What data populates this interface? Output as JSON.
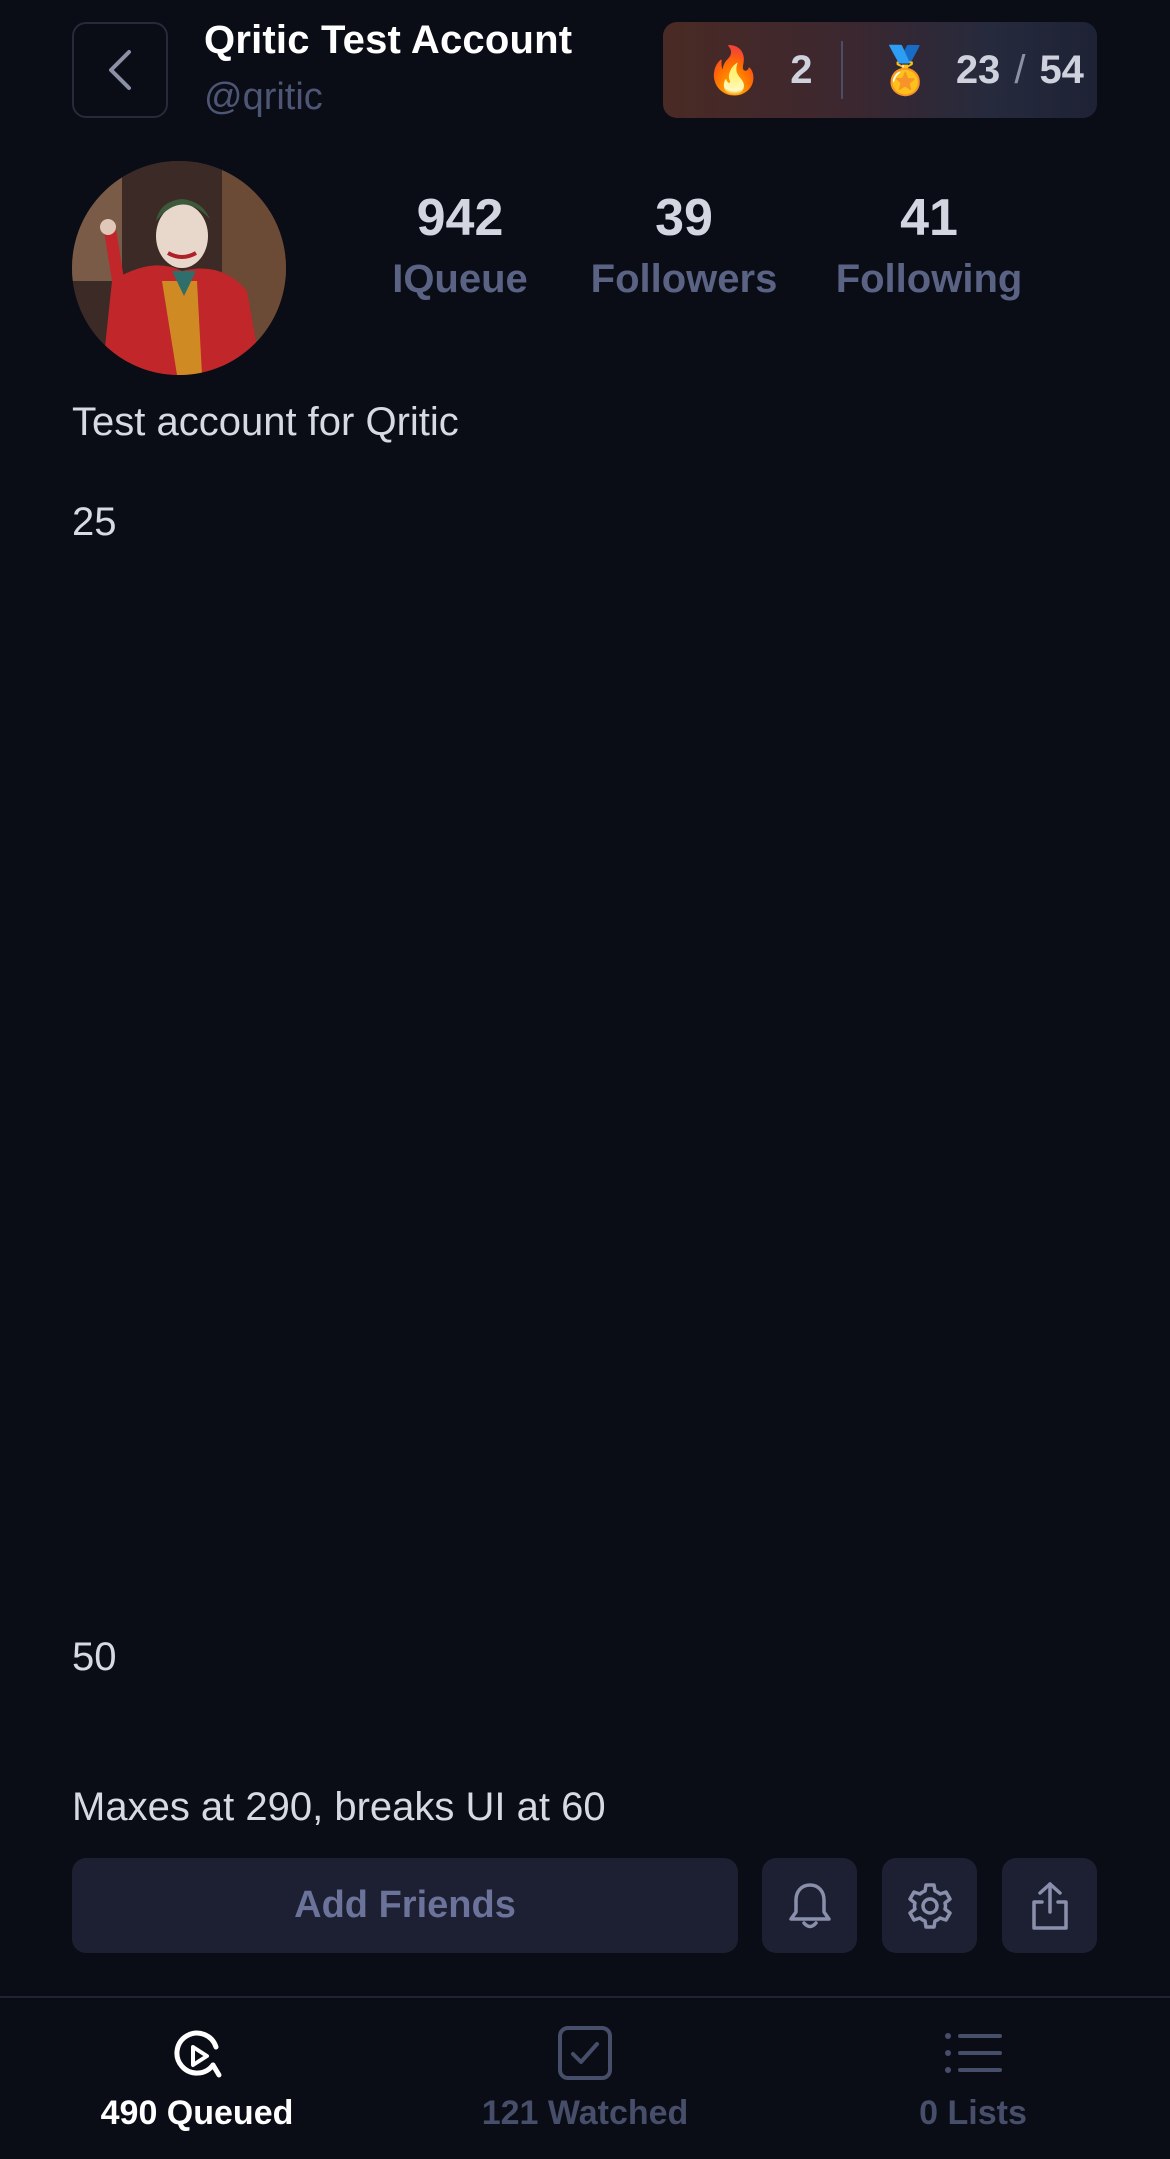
{
  "header": {
    "title": "Qritic Test Account",
    "handle": "@qritic",
    "streak_count": "2",
    "badges_earned": "23",
    "badges_separator": "/",
    "badges_total": "54"
  },
  "stats": [
    {
      "value": "942",
      "label": "IQueue"
    },
    {
      "value": "39",
      "label": "Followers"
    },
    {
      "value": "41",
      "label": "Following"
    }
  ],
  "bio": {
    "line1": "Test account for Qritic",
    "line2": "25",
    "line3": "50",
    "line4": "Maxes at 290, breaks UI at 60"
  },
  "actions": {
    "add_friends_label": "Add Friends"
  },
  "tabs": [
    {
      "label": "490 Queued",
      "icon": "queue-icon",
      "active": true
    },
    {
      "label": "121 Watched",
      "icon": "watched-icon",
      "active": false
    },
    {
      "label": "0 Lists",
      "icon": "list-icon",
      "active": false
    }
  ],
  "colors": {
    "background": "#0a0c16",
    "button_bg": "#1c2032",
    "muted_text": "#5a6384"
  }
}
